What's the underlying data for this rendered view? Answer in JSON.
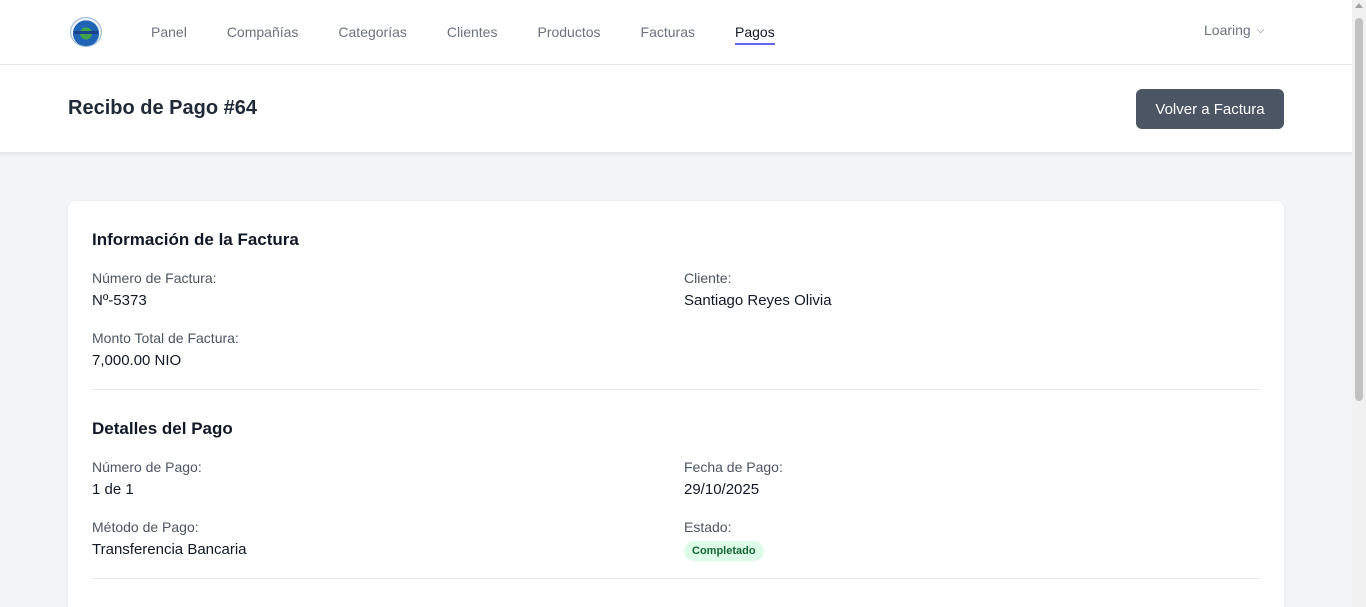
{
  "nav": {
    "items": [
      "Panel",
      "Compañías",
      "Categorías",
      "Clientes",
      "Productos",
      "Facturas",
      "Pagos"
    ],
    "active": "Pagos",
    "user": "Loaring"
  },
  "header": {
    "title": "Recibo de Pago #64",
    "back_button": "Volver a Factura"
  },
  "invoice": {
    "title": "Información de la Factura",
    "number_label": "Número de Factura:",
    "number_value": "Nº-5373",
    "client_label": "Cliente:",
    "client_value": "Santiago Reyes Olivia",
    "total_label": "Monto Total de Factura:",
    "total_value": "7,000.00 NIO"
  },
  "payment": {
    "title": "Detalles del Pago",
    "number_label": "Número de Pago:",
    "number_value": "1 de 1",
    "date_label": "Fecha de Pago:",
    "date_value": "29/10/2025",
    "method_label": "Método de Pago:",
    "method_value": "Transferencia Bancaria",
    "status_label": "Estado:",
    "status_value": "Completado"
  },
  "colors": {
    "accent": "#6366f1",
    "button": "#4b5563",
    "badge_bg": "#dcfce7",
    "badge_text": "#166534"
  }
}
